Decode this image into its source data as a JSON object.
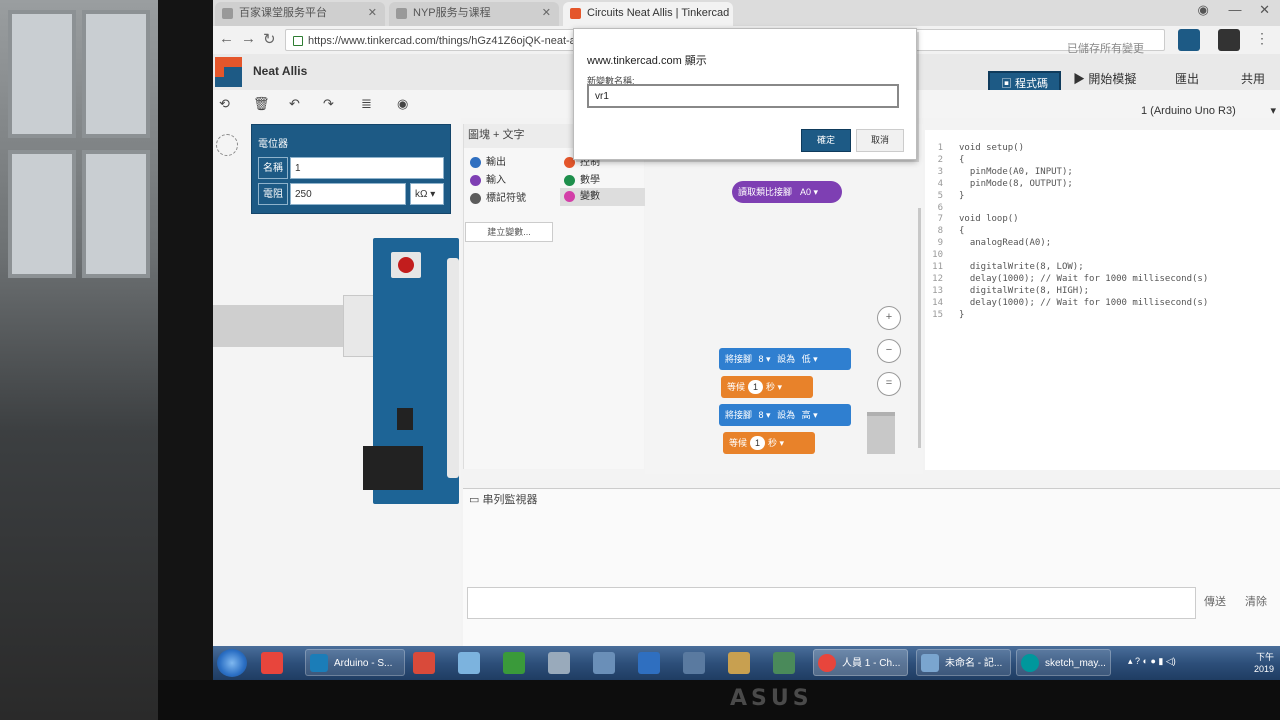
{
  "browser": {
    "tabs": [
      {
        "title": "百家课堂服务平台",
        "active": false
      },
      {
        "title": "NYP服务与课程",
        "active": false
      },
      {
        "title": "Circuits Neat Allis | Tinkercad",
        "active": true
      }
    ],
    "url": "https://www.tinkercad.com/things/hGz41Z6ojQK-neat-allis/editel?tenant=circuits"
  },
  "app": {
    "project_name": "Neat Allis",
    "save_status": "已儲存所有變更",
    "code_button": "程式碼",
    "simulate_button": "開始模擬",
    "export_button": "匯出",
    "share_button": "共用",
    "board_select": "1 (Arduino Uno R3)"
  },
  "component": {
    "title": "電位器",
    "name_label": "名稱",
    "name_value": "1",
    "resistance_label": "電阻",
    "resistance_value": "250",
    "resistance_unit": "kΩ"
  },
  "palette": {
    "header": "圖塊 + 文字",
    "categories": [
      {
        "label": "輸出",
        "color": "#2f6fc0"
      },
      {
        "label": "控制",
        "color": "#e4562b"
      },
      {
        "label": "輸入",
        "color": "#7e3fb3"
      },
      {
        "label": "數學",
        "color": "#1e8f4c"
      },
      {
        "label": "標記符號",
        "color": "#5c5c5c"
      },
      {
        "label": "變數",
        "color": "#d33fa8"
      }
    ],
    "new_variable": "建立變數..."
  },
  "workspace": {
    "read_block": "讀取類比接腳",
    "read_pin": "A0",
    "set_pin_label": "將接腳",
    "pin": "8",
    "set_to": "設為",
    "low": "低",
    "high": "高",
    "wait_label": "等候",
    "wait_value": "1",
    "seconds": "秒"
  },
  "code_lines": [
    {
      "n": "1",
      "t": "void setup()"
    },
    {
      "n": "2",
      "t": "{"
    },
    {
      "n": "3",
      "t": "  pinMode(A0, INPUT);"
    },
    {
      "n": "4",
      "t": "  pinMode(8, OUTPUT);"
    },
    {
      "n": "5",
      "t": "}"
    },
    {
      "n": "6",
      "t": ""
    },
    {
      "n": "7",
      "t": "void loop()"
    },
    {
      "n": "8",
      "t": "{"
    },
    {
      "n": "9",
      "t": "  analogRead(A0);"
    },
    {
      "n": "10",
      "t": ""
    },
    {
      "n": "11",
      "t": "  digitalWrite(8, LOW);"
    },
    {
      "n": "12",
      "t": "  delay(1000); // Wait for 1000 millisecond(s)"
    },
    {
      "n": "13",
      "t": "  digitalWrite(8, HIGH);"
    },
    {
      "n": "14",
      "t": "  delay(1000); // Wait for 1000 millisecond(s)"
    },
    {
      "n": "15",
      "t": "}"
    }
  ],
  "serial": {
    "title": "串列監視器",
    "send": "傳送",
    "clear": "清除"
  },
  "dialog": {
    "title": "www.tinkercad.com 顯示",
    "label": "新變數名稱:",
    "input_value": "vr1",
    "ok": "確定",
    "cancel": "取消"
  },
  "taskbar": {
    "items": [
      {
        "label": "Arduino - S...",
        "color": "#1b7db8"
      },
      {
        "label": "人員 1 - Ch...",
        "color": "#e8453c"
      },
      {
        "label": "未命名 - 記...",
        "color": "#7aa5cf"
      },
      {
        "label": "sketch_may...",
        "color": "#00979c"
      }
    ],
    "clock_top": "下午",
    "clock_bottom": "2019"
  },
  "bezel_brand": "ASUS"
}
